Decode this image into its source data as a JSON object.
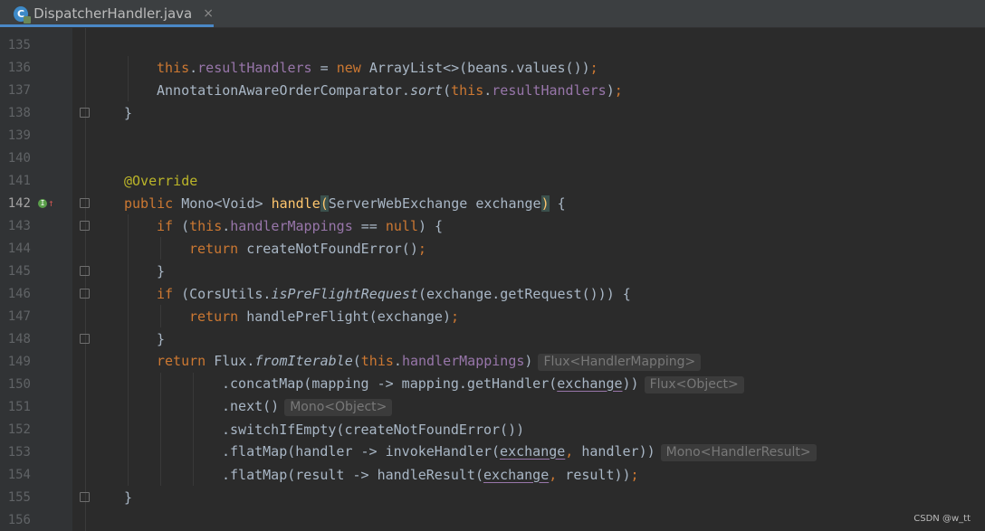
{
  "tab": {
    "filename": "DispatcherHandler.java",
    "icon": "java-class-icon",
    "close": "×"
  },
  "watermark": "CSDN @w_tt",
  "lines": [
    {
      "n": "135",
      "indent": 0,
      "tokens": []
    },
    {
      "n": "136",
      "indent": 2,
      "tokens": [
        {
          "t": "this",
          "c": "kw"
        },
        {
          "t": ".",
          "c": "plain"
        },
        {
          "t": "resultHandlers",
          "c": "field"
        },
        {
          "t": " = ",
          "c": "plain"
        },
        {
          "t": "new ",
          "c": "kw"
        },
        {
          "t": "ArrayList<>(beans.values())",
          "c": "plain"
        },
        {
          "t": ";",
          "c": "kw"
        }
      ]
    },
    {
      "n": "137",
      "indent": 2,
      "tokens": [
        {
          "t": "AnnotationAwareOrderComparator.",
          "c": "plain"
        },
        {
          "t": "sort",
          "c": "static"
        },
        {
          "t": "(",
          "c": "plain"
        },
        {
          "t": "this",
          "c": "kw"
        },
        {
          "t": ".",
          "c": "plain"
        },
        {
          "t": "resultHandlers",
          "c": "field"
        },
        {
          "t": ")",
          "c": "plain"
        },
        {
          "t": ";",
          "c": "kw"
        }
      ]
    },
    {
      "n": "138",
      "indent": 1,
      "fold": true,
      "tokens": [
        {
          "t": "}",
          "c": "plain"
        }
      ]
    },
    {
      "n": "139",
      "indent": 0,
      "tokens": []
    },
    {
      "n": "140",
      "indent": 0,
      "tokens": []
    },
    {
      "n": "141",
      "indent": 1,
      "tokens": [
        {
          "t": "@Override",
          "c": "ann"
        }
      ]
    },
    {
      "n": "142",
      "indent": 1,
      "current": true,
      "fold": true,
      "marker": true,
      "tokens": [
        {
          "t": "public ",
          "c": "kw"
        },
        {
          "t": "Mono<Void> ",
          "c": "plain"
        },
        {
          "t": "handle",
          "c": "method"
        },
        {
          "t": "(",
          "c": "cursor"
        },
        {
          "t": "ServerWebExchange exchange",
          "c": "plain"
        },
        {
          "t": ")",
          "c": "cursor"
        },
        {
          "t": " {",
          "c": "plain"
        }
      ]
    },
    {
      "n": "143",
      "indent": 2,
      "fold": true,
      "tokens": [
        {
          "t": "if ",
          "c": "kw"
        },
        {
          "t": "(",
          "c": "plain"
        },
        {
          "t": "this",
          "c": "kw"
        },
        {
          "t": ".",
          "c": "plain"
        },
        {
          "t": "handlerMappings",
          "c": "field"
        },
        {
          "t": " == ",
          "c": "plain"
        },
        {
          "t": "null",
          "c": "kw"
        },
        {
          "t": ") {",
          "c": "plain"
        }
      ]
    },
    {
      "n": "144",
      "indent": 3,
      "tokens": [
        {
          "t": "return ",
          "c": "kw"
        },
        {
          "t": "createNotFoundError()",
          "c": "plain"
        },
        {
          "t": ";",
          "c": "kw"
        }
      ]
    },
    {
      "n": "145",
      "indent": 2,
      "fold": true,
      "tokens": [
        {
          "t": "}",
          "c": "plain"
        }
      ]
    },
    {
      "n": "146",
      "indent": 2,
      "fold": true,
      "tokens": [
        {
          "t": "if ",
          "c": "kw"
        },
        {
          "t": "(CorsUtils.",
          "c": "plain"
        },
        {
          "t": "isPreFlightRequest",
          "c": "static"
        },
        {
          "t": "(exchange.getRequest())) {",
          "c": "plain"
        }
      ]
    },
    {
      "n": "147",
      "indent": 3,
      "tokens": [
        {
          "t": "return ",
          "c": "kw"
        },
        {
          "t": "handlePreFlight(exchange)",
          "c": "plain"
        },
        {
          "t": ";",
          "c": "kw"
        }
      ]
    },
    {
      "n": "148",
      "indent": 2,
      "fold": true,
      "tokens": [
        {
          "t": "}",
          "c": "plain"
        }
      ]
    },
    {
      "n": "149",
      "indent": 2,
      "hint": "Flux<HandlerMapping>",
      "tokens": [
        {
          "t": "return ",
          "c": "kw"
        },
        {
          "t": "Flux.",
          "c": "plain"
        },
        {
          "t": "fromIterable",
          "c": "static"
        },
        {
          "t": "(",
          "c": "plain"
        },
        {
          "t": "this",
          "c": "kw"
        },
        {
          "t": ".",
          "c": "plain"
        },
        {
          "t": "handlerMappings",
          "c": "field"
        },
        {
          "t": ")",
          "c": "plain"
        }
      ]
    },
    {
      "n": "150",
      "indent": 4,
      "hint": "Flux<Object>",
      "tokens": [
        {
          "t": ".concatMap(mapping -> mapping.getHandler(",
          "c": "plain"
        },
        {
          "t": "exchange",
          "c": "under"
        },
        {
          "t": "))",
          "c": "plain"
        }
      ]
    },
    {
      "n": "151",
      "indent": 4,
      "hint": "Mono<Object>",
      "tokens": [
        {
          "t": ".next()",
          "c": "plain"
        }
      ]
    },
    {
      "n": "152",
      "indent": 4,
      "tokens": [
        {
          "t": ".switchIfEmpty(createNotFoundError())",
          "c": "plain"
        }
      ]
    },
    {
      "n": "153",
      "indent": 4,
      "hint": "Mono<HandlerResult>",
      "tokens": [
        {
          "t": ".flatMap(handler -> invokeHandler(",
          "c": "plain"
        },
        {
          "t": "exchange",
          "c": "under"
        },
        {
          "t": ", ",
          "c": "kw"
        },
        {
          "t": "handler))",
          "c": "plain"
        }
      ]
    },
    {
      "n": "154",
      "indent": 4,
      "tokens": [
        {
          "t": ".flatMap(result -> handleResult(",
          "c": "plain"
        },
        {
          "t": "exchange",
          "c": "under"
        },
        {
          "t": ", ",
          "c": "kw"
        },
        {
          "t": "result))",
          "c": "plain"
        },
        {
          "t": ";",
          "c": "kw"
        }
      ]
    },
    {
      "n": "155",
      "indent": 1,
      "fold": true,
      "tokens": [
        {
          "t": "}",
          "c": "plain"
        }
      ]
    },
    {
      "n": "156",
      "indent": 0,
      "tokens": []
    }
  ]
}
